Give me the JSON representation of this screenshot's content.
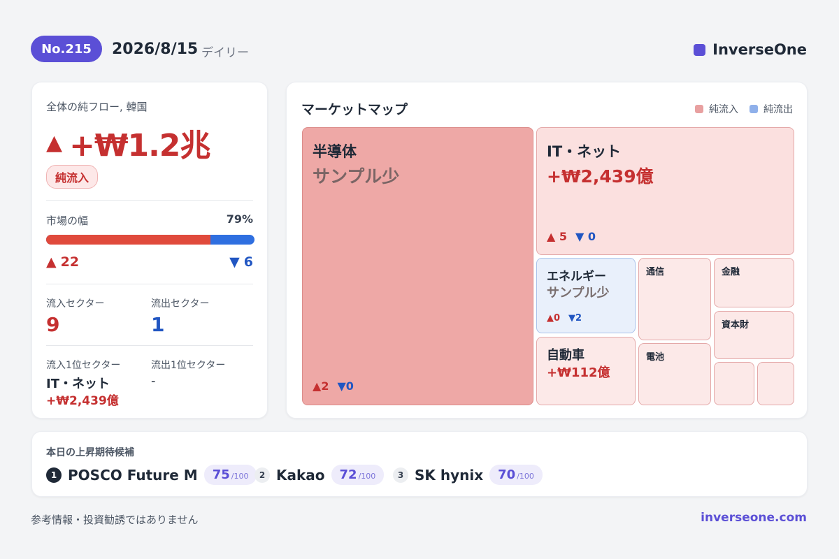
{
  "header": {
    "number": "No.215",
    "date": "2026/8/15",
    "type": "デイリー",
    "brand": "InverseOne"
  },
  "summary": {
    "label": "全体の純フロー, 韓国",
    "value": "+₩1.2兆",
    "badge": "純流入",
    "breadth_label": "市場の幅",
    "breadth_pct_text": "79%",
    "breadth_fraction": 0.79,
    "up_count": "22",
    "down_count": "6",
    "inflow_sectors_label": "流入セクター",
    "inflow_sectors": "9",
    "outflow_sectors_label": "流出セクター",
    "outflow_sectors": "1",
    "top_inflow_label": "流入1位セクター",
    "top_inflow_name": "IT・ネット",
    "top_inflow_value": "+₩2,439億",
    "top_outflow_label": "流出1位セクター",
    "top_outflow_name": "-"
  },
  "market_map": {
    "title": "マーケットマップ",
    "legend_in": "純流入",
    "legend_out": "純流出",
    "sectors": {
      "semis": {
        "name": "半導体",
        "sub": "サンプル少",
        "up": "2",
        "down": "0"
      },
      "it": {
        "name": "IT・ネット",
        "sub": "+₩2,439億",
        "up": "5",
        "down": "0"
      },
      "energy": {
        "name": "エネルギー",
        "sub": "サンプル少",
        "up": "0",
        "down": "2"
      },
      "telecom": {
        "name": "通信"
      },
      "finance": {
        "name": "金融"
      },
      "capital": {
        "name": "資本財"
      },
      "auto": {
        "name": "自動車",
        "sub": "+₩112億"
      },
      "battery": {
        "name": "電池"
      }
    }
  },
  "candidates": {
    "title": "本日の上昇期待候補",
    "max": "/100",
    "items": [
      {
        "rank": "1",
        "name": "POSCO Future M",
        "score": "75"
      },
      {
        "rank": "2",
        "name": "Kakao",
        "score": "72"
      },
      {
        "rank": "3",
        "name": "SK hynix",
        "score": "70"
      }
    ]
  },
  "footer": {
    "disclaimer": "参考情報・投資勧誘ではありません",
    "site": "inverseone.com"
  },
  "colors": {
    "accent": "#5b4fd6",
    "inflow": "#c53030",
    "outflow": "#2156c2"
  }
}
